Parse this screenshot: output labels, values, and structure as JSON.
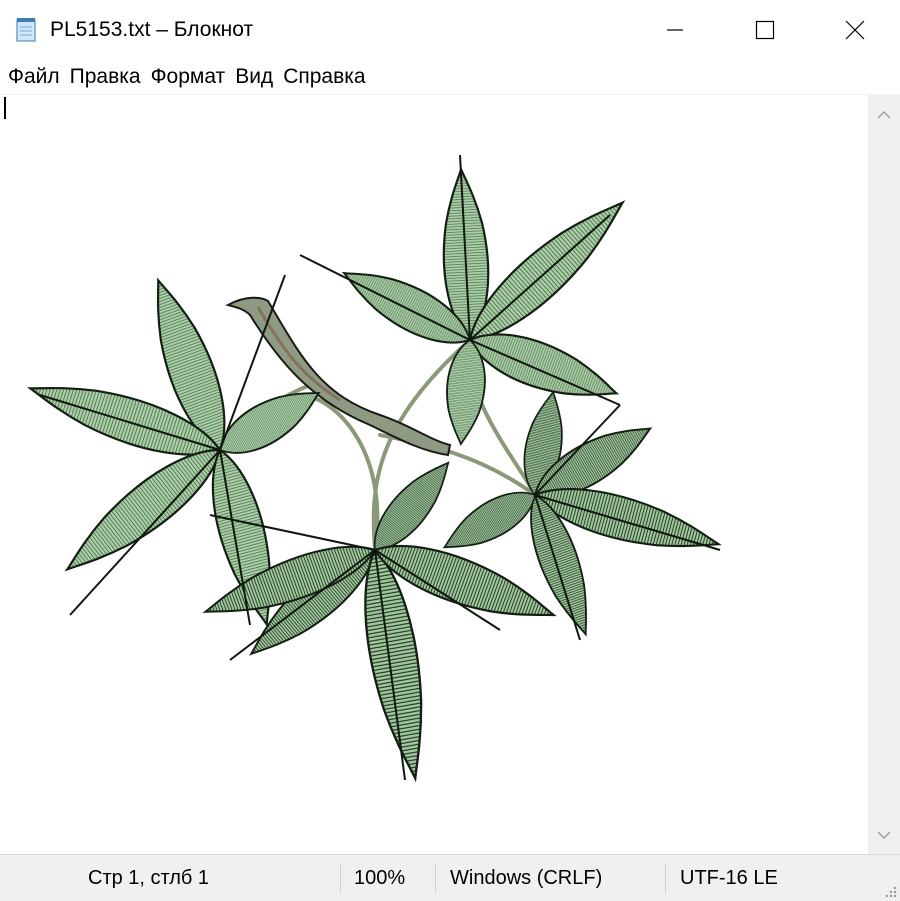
{
  "window": {
    "title": "PL5153.txt – Блокнот",
    "icon": "notepad-icon",
    "controls": [
      "minimize-icon",
      "maximize-icon",
      "close-icon"
    ]
  },
  "menu": {
    "items": [
      {
        "label": "Файл"
      },
      {
        "label": "Правка"
      },
      {
        "label": "Формат"
      },
      {
        "label": "Вид"
      },
      {
        "label": "Справка"
      }
    ]
  },
  "status": {
    "position": "Стр 1, стлб 1",
    "zoom": "100%",
    "line_ending": "Windows (CRLF)",
    "encoding": "UTF-16 LE"
  },
  "colors": {
    "leaf_fill": "#a9cfa6",
    "leaf_outline": "#141f14",
    "stem": "#8a9a78",
    "branch": "#6b5a4d"
  }
}
